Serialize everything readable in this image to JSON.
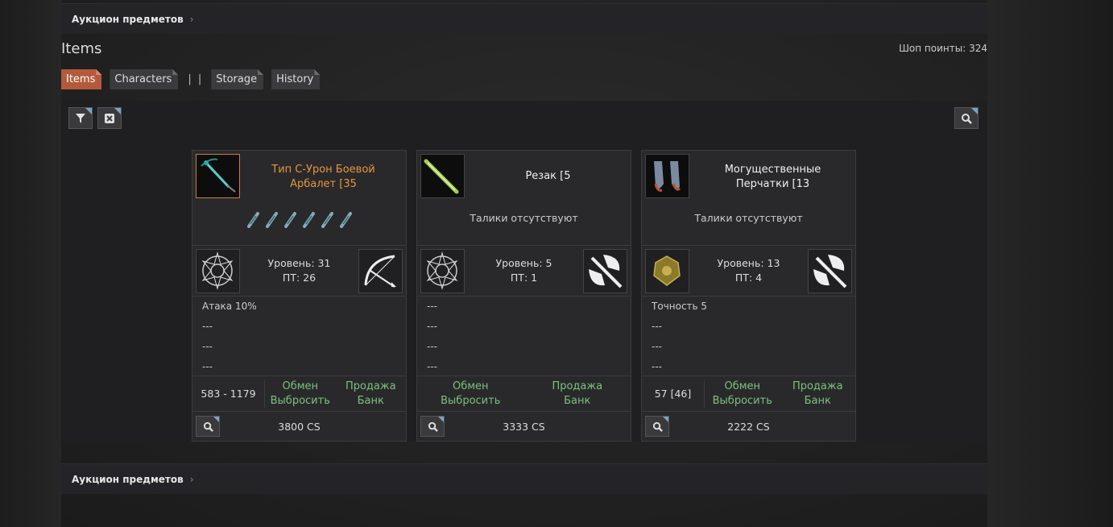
{
  "breadcrumb": {
    "label": "Аукцион предметов"
  },
  "page": {
    "title": "Items",
    "shop_points": "Шоп поинты: 324"
  },
  "tabs": [
    {
      "label": "Items",
      "active": true
    },
    {
      "label": "Characters"
    },
    {
      "label": "Storage"
    },
    {
      "label": "History"
    }
  ],
  "tab_separator": "| |",
  "toolbar": {
    "filter_icon": "filter-icon",
    "clear_icon": "clear-icon",
    "search_icon": "search-icon"
  },
  "cards": [
    {
      "name": "Тип С-Урон Боевой Арбалет [35",
      "name_color": "#e8963a",
      "talismans_text": "",
      "talisman_count": 6,
      "level": "Уровень: 31",
      "pt": "ПТ: 26",
      "type_icon": "bow-icon",
      "attrs": [
        "Атака 10%",
        "---",
        "---",
        "---"
      ],
      "price_range": "583 - 1179",
      "actions_left": [
        "Обмен",
        "Выбросить"
      ],
      "actions_right": [
        "Продажа",
        "Банк"
      ],
      "cost": "3800 CS"
    },
    {
      "name": "Резак [5",
      "name_color": "#f0f0f0",
      "talismans_text": "Талики отсутствуют",
      "level": "Уровень: 5",
      "pt": "ПТ: 1",
      "type_icon": "axe-icon",
      "attrs": [
        "---",
        "---",
        "---",
        "---"
      ],
      "price_range": "",
      "actions_left": [
        "Обмен",
        "Выбросить"
      ],
      "actions_right": [
        "Продажа",
        "Банк"
      ],
      "cost": "3333 CS"
    },
    {
      "name": "Могущественные Перчатки [13",
      "name_color": "#f0f0f0",
      "talismans_text": "Талики отсутствуют",
      "level": "Уровень: 13",
      "pt": "ПТ: 4",
      "type_icon": "axe-icon",
      "attrs": [
        "Точность 5",
        "---",
        "---",
        "---"
      ],
      "price_range": "57 [46]",
      "actions_left": [
        "Обмен",
        "Выбросить"
      ],
      "actions_right": [
        "Продажа",
        "Банк"
      ],
      "cost": "2222 CS"
    }
  ]
}
